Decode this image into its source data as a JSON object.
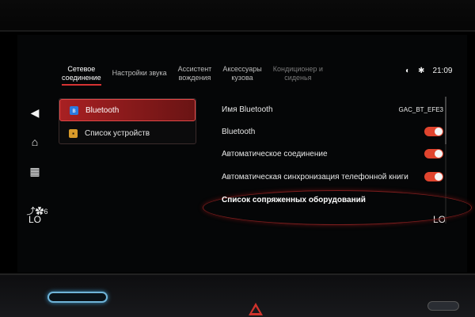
{
  "tabs": [
    {
      "label": "Сетевое\nсоединение",
      "active": true
    },
    {
      "label": "Настройки звука",
      "active": false
    },
    {
      "label": "Ассистент\nвождения",
      "active": false
    },
    {
      "label": "Аксессуары\nкузова",
      "active": false
    },
    {
      "label": "Кондиционер и\nсиденья",
      "active": false
    }
  ],
  "status": {
    "time": "21:09",
    "icons": [
      "wifi-icon",
      "bluetooth-icon"
    ]
  },
  "left_rail": {
    "back": "◀",
    "home": "⌂",
    "apps": "▦",
    "seat_level": "6"
  },
  "climate": {
    "left_temp": "LO",
    "right_temp": "LO"
  },
  "menu": {
    "items": [
      {
        "label": "Bluetooth",
        "active": true,
        "icon": "bluetooth-icon"
      },
      {
        "label": "Список устройств",
        "active": false,
        "icon": "device-list-icon"
      }
    ]
  },
  "settings": {
    "bt_name_label": "Имя Bluetooth",
    "bt_name_value": "GAC_BT_EFE3",
    "bluetooth_label": "Bluetooth",
    "auto_connect_label": "Автоматическое соединение",
    "auto_sync_label": "Автоматическая синхронизация телефонной книги",
    "paired_header": "Список сопряженных оборудований"
  },
  "colors": {
    "accent": "#d63232",
    "toggle_on": "#e0442e",
    "bt_badge": "#2a7ae0",
    "device_badge": "#d89a2a"
  }
}
